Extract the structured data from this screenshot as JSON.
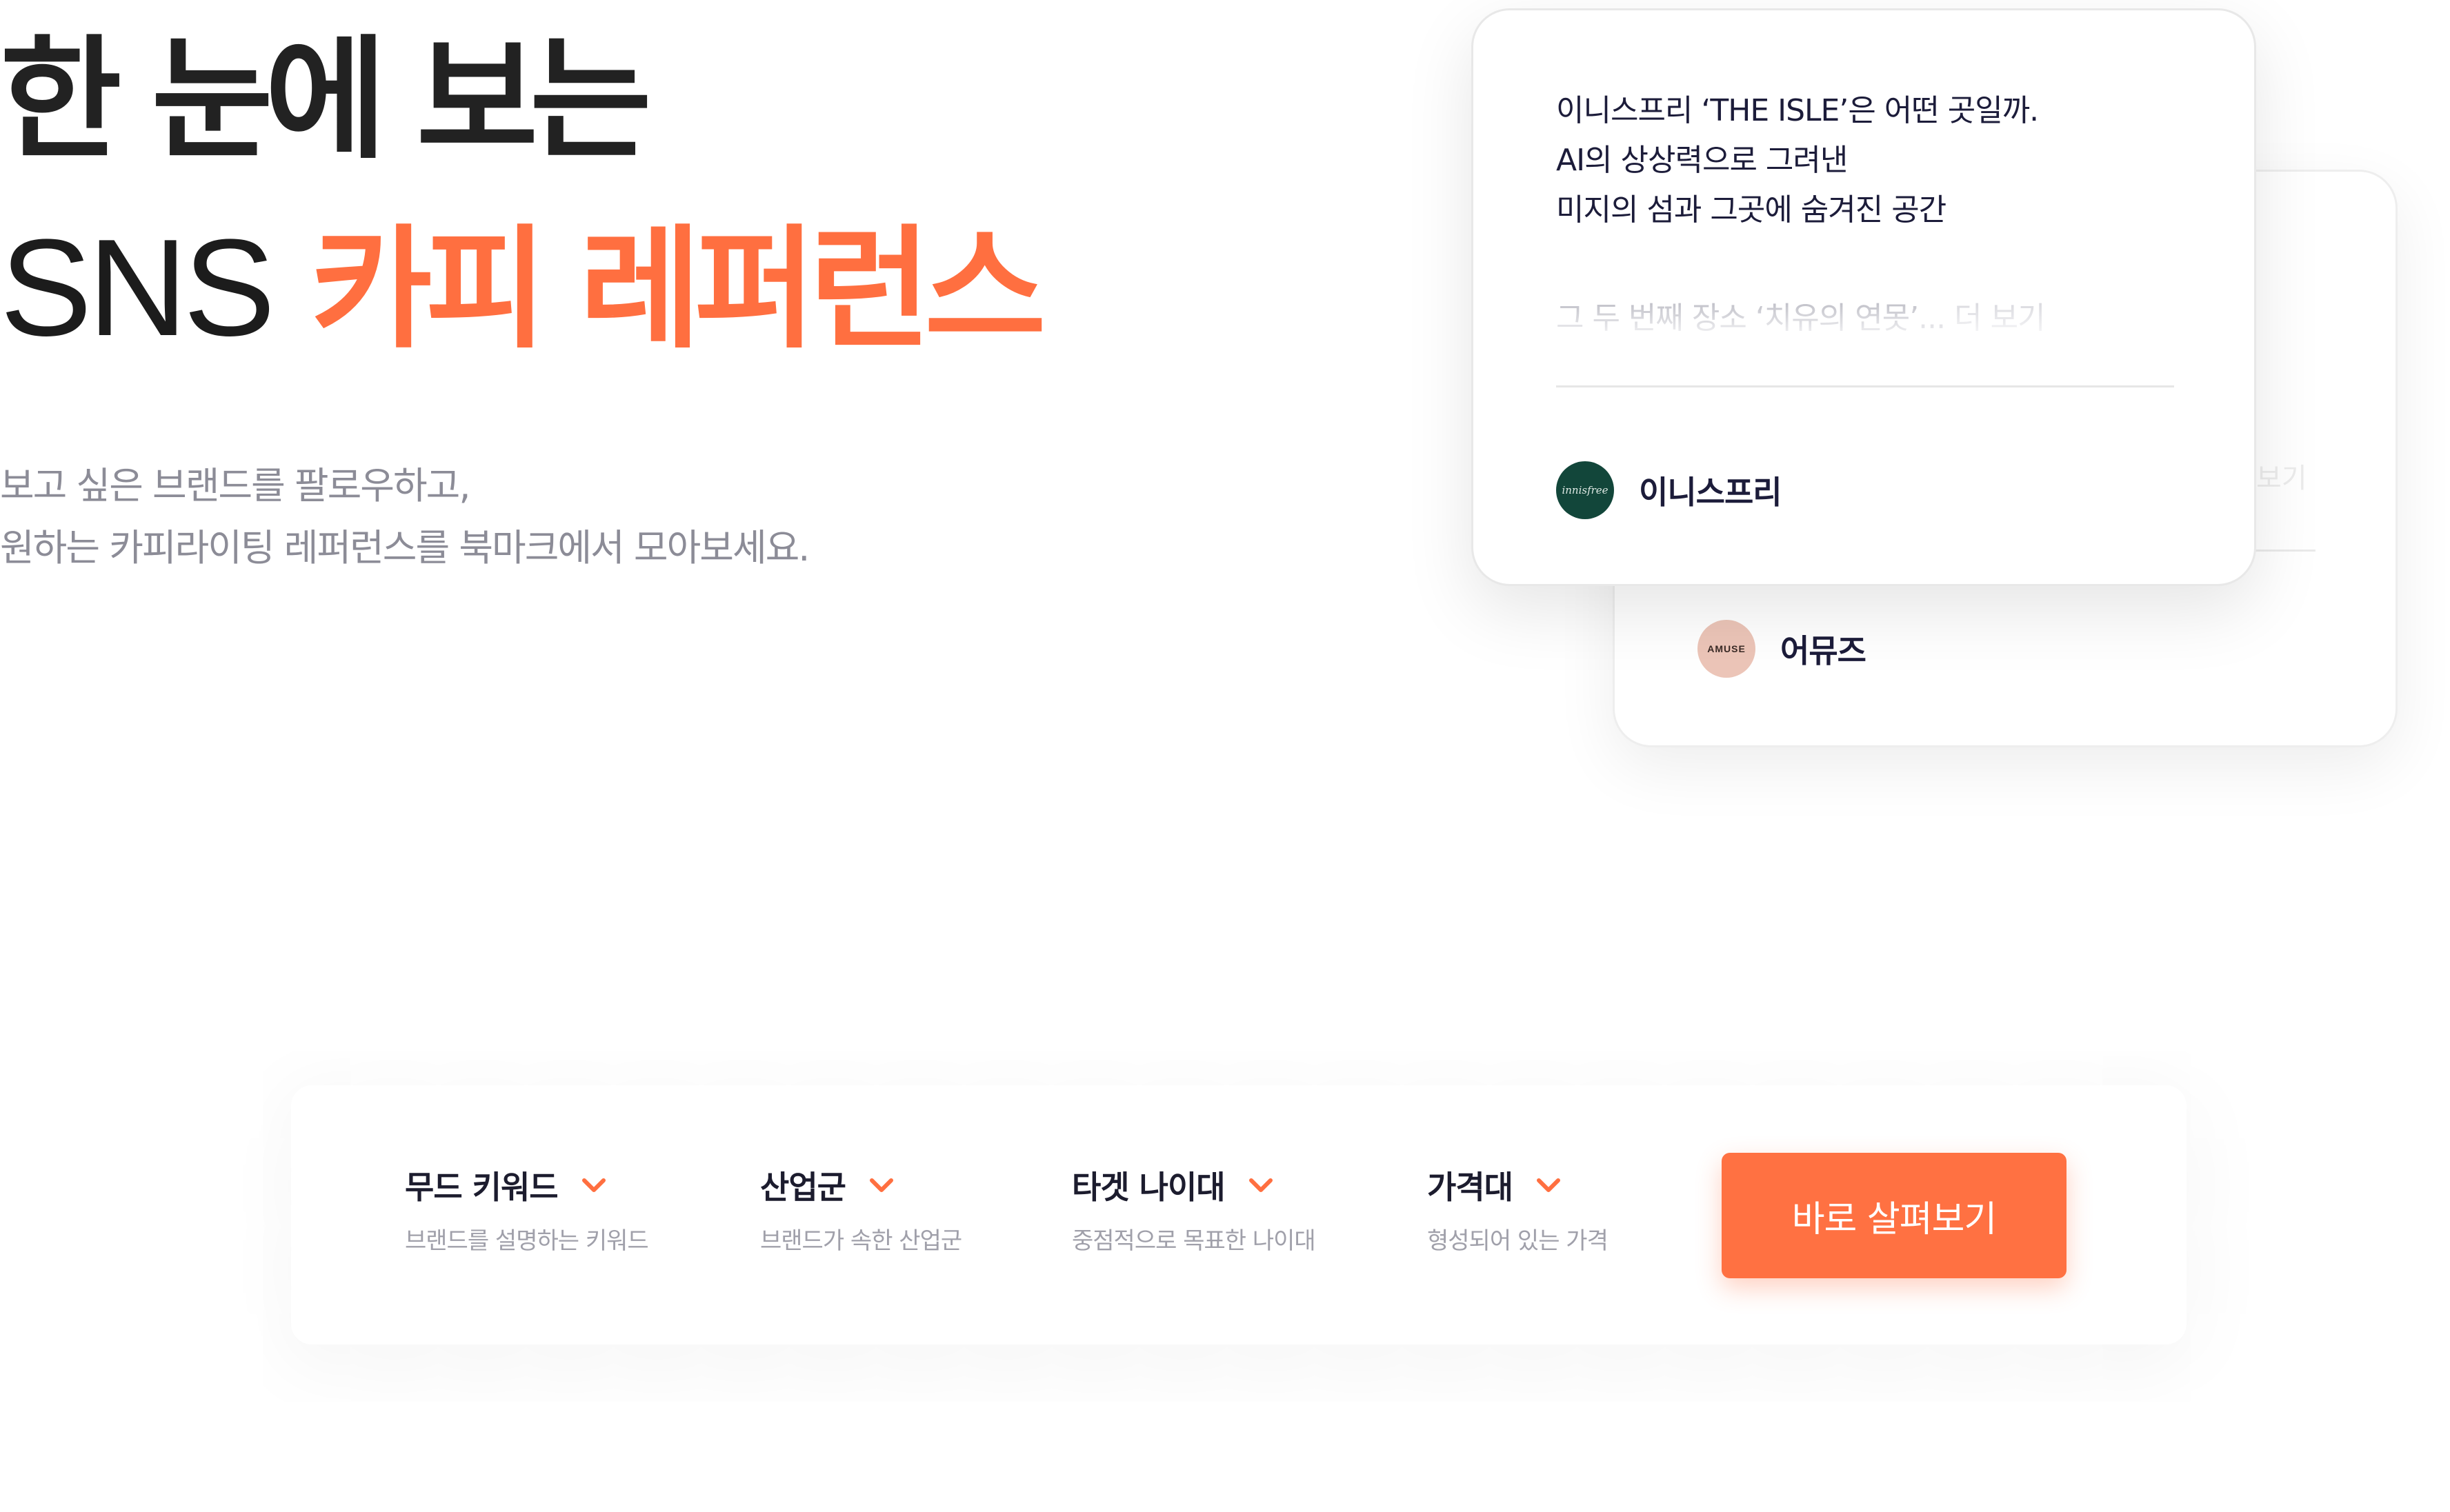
{
  "hero": {
    "title_line1": "한 눈에 보는",
    "title_line2_prefix": "SNS",
    "title_line2_accent": "카피 레퍼런스",
    "subtitle_line1": "보고 싶은 브랜드를 팔로우하고,",
    "subtitle_line2": "원하는 카피라이팅 레퍼런스를 북마크에서 모아보세요."
  },
  "cards": {
    "front": {
      "body_line1": "이니스프리 ‘THE ISLE’은 어떤 곳일까.",
      "body_line2": "AI의 상상력으로 그려낸",
      "body_line3": "미지의 섬과 그곳에 숨겨진 공간",
      "teaser": "그 두 번째 장소 ‘치유의 연못’...",
      "more": "더 보기",
      "brand_name": "이니스프리",
      "avatar_text": "innisfree"
    },
    "back": {
      "more": "보기",
      "brand_name": "어뮤즈",
      "avatar_text": "AMUSE"
    }
  },
  "filters": [
    {
      "label": "무드 키워드",
      "desc": "브랜드를 설명하는 키워드"
    },
    {
      "label": "산업군",
      "desc": "브랜드가 속한 산업군"
    },
    {
      "label": "타겟 나이대",
      "desc": "중점적으로 목표한 나이대"
    },
    {
      "label": "가격대",
      "desc": "형성되어 있는 가격"
    }
  ],
  "cta_label": "바로 살펴보기",
  "icons": {
    "filter_dropdown": "chevron-down-icon"
  },
  "colors": {
    "accent": "#ff6f40",
    "cta": "#ff7142",
    "title": "#222222",
    "subtitle": "#8c8c97",
    "innisfree_avatar": "#12463a",
    "amuse_avatar": "#ecc5b8"
  }
}
